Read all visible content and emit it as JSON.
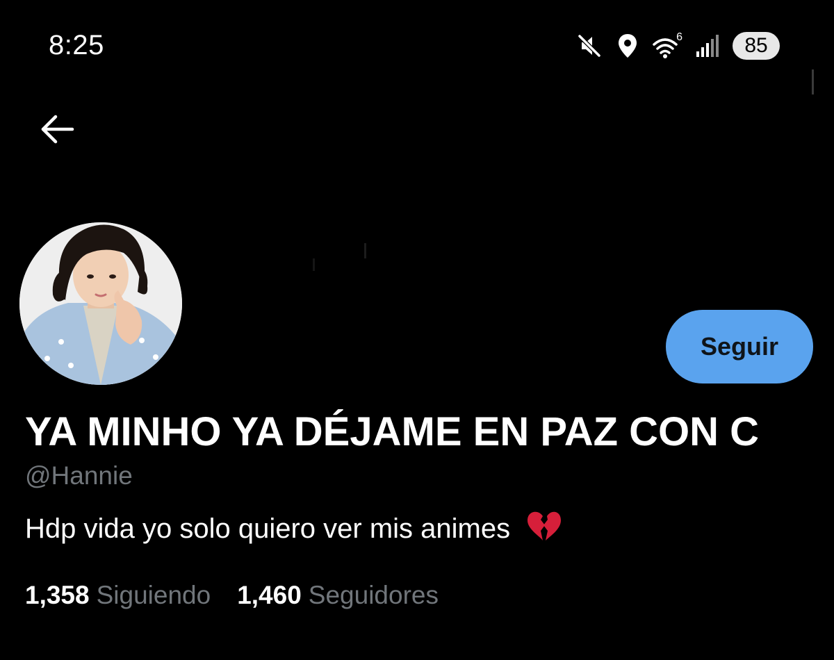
{
  "status_bar": {
    "time": "8:25",
    "icons": [
      "mute-icon",
      "location-icon",
      "wifi-6-icon",
      "signal-icon"
    ],
    "wifi_badge": "6",
    "battery": "85"
  },
  "header": {
    "back_icon": "arrow-left-icon"
  },
  "profile": {
    "display_name": "YA MINHO YA DÉJAME EN PAZ CON C",
    "username": "@Hannie",
    "bio": "Hdp vida yo solo quiero ver mis animes",
    "bio_emoji": "broken-heart-icon",
    "follow_label": "Seguir",
    "stats": {
      "following_count": "1,358",
      "following_label": "Siguiendo",
      "followers_count": "1,460",
      "followers_label": "Seguidores"
    }
  },
  "colors": {
    "background": "#000000",
    "text_primary": "#ffffff",
    "text_secondary": "#71767b",
    "follow_button": "#5aa3ee",
    "follow_text": "#0f1419",
    "battery_badge": "#e8e8e8",
    "emoji_red": "#d61f3a"
  }
}
